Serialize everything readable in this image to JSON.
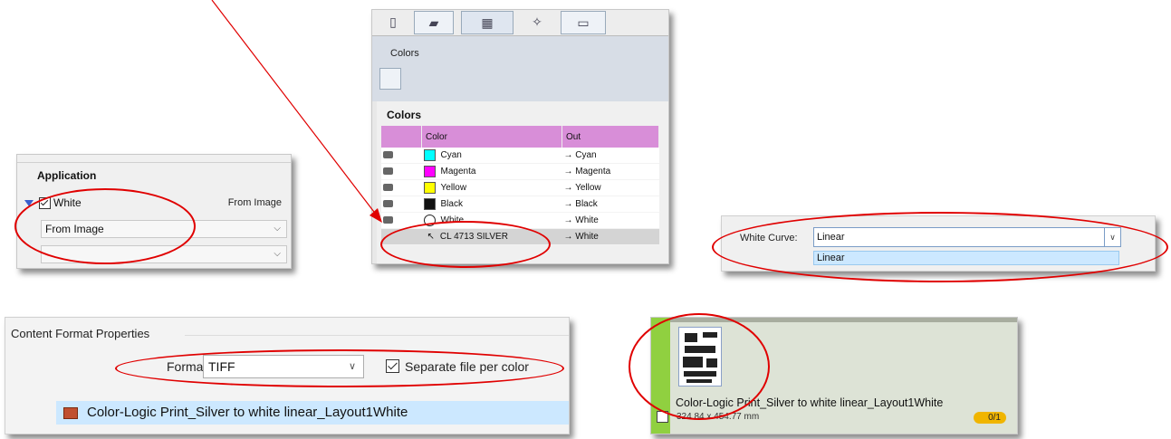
{
  "application_panel": {
    "title": "Application",
    "white_label": "White",
    "white_checked": true,
    "from_image_label": "From Image",
    "select1_value": "From Image",
    "select2_value": ""
  },
  "colors_panel": {
    "tab_label": "Colors",
    "section_title": "Colors",
    "columns": [
      "Color",
      "Out"
    ],
    "rows": [
      {
        "name": "Cyan",
        "out": "→ Cyan",
        "swatch": "#00ffff"
      },
      {
        "name": "Magenta",
        "out": "→ Magenta",
        "swatch": "#ff00ff"
      },
      {
        "name": "Yellow",
        "out": "→ Yellow",
        "swatch": "#ffff00"
      },
      {
        "name": "Black",
        "out": "→ Black",
        "swatch": "#111111"
      },
      {
        "name": "White",
        "out": "→ White",
        "swatch": "circle"
      },
      {
        "name": "CL 4713 SILVER",
        "out": "→ White",
        "prefix": "↖"
      }
    ]
  },
  "curve_panel": {
    "label": "White Curve:",
    "value": "Linear",
    "option": "Linear"
  },
  "format_panel": {
    "group_title": "Content Format Properties",
    "format_label": "Format",
    "format_value": "TIFF",
    "separate_label": "Separate file per color",
    "separate_checked": true,
    "file_name": "Color-Logic Print_Silver to white linear_Layout1White"
  },
  "thumb_panel": {
    "file_name": "Color-Logic Print_Silver to white linear_Layout1White",
    "dimensions": "324.84 x 454.77 mm",
    "badge": "0/1"
  },
  "colors": {
    "annotation": "#e00000",
    "header": "#d88ed8",
    "selection": "#cce8ff",
    "accent_green": "#90d040"
  }
}
